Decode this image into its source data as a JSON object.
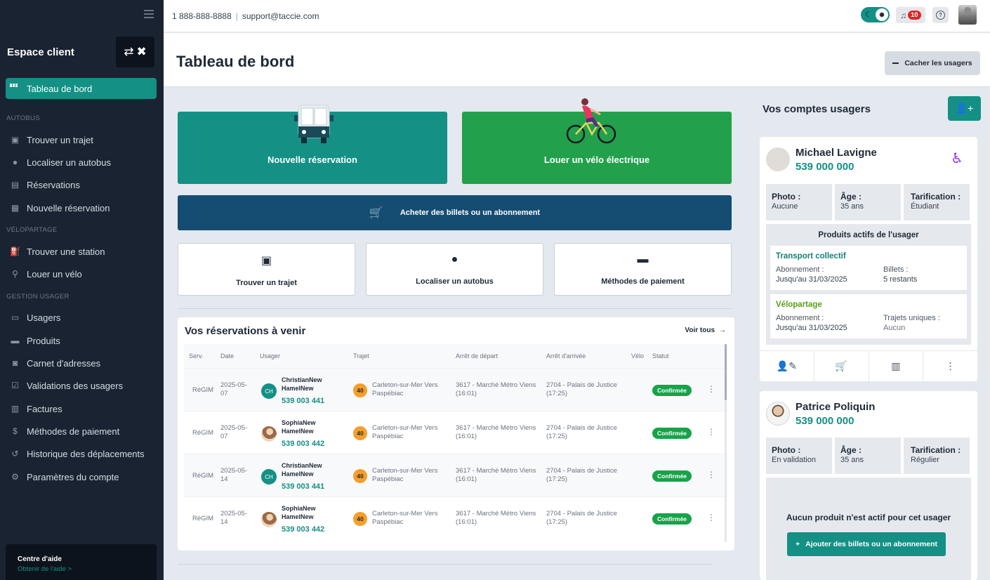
{
  "sidebar": {
    "title": "Espace client",
    "active": "Tableau de bord",
    "sections": {
      "autobus": "AUTOBUS",
      "velo": "VÉLOPARTAGE",
      "gestion": "GESTION USAGER"
    },
    "items": [
      {
        "label": "Trouver un trajet",
        "icon": "bus-icon"
      },
      {
        "label": "Localiser un autobus",
        "icon": "location-pin-icon"
      },
      {
        "label": "Réservations",
        "icon": "calendar-icon"
      },
      {
        "label": "Nouvelle réservation",
        "icon": "calendar-plus-icon"
      },
      {
        "label": "Trouver une station",
        "icon": "station-icon"
      },
      {
        "label": "Louer un vélo",
        "icon": "bike-icon"
      },
      {
        "label": "Usagers",
        "icon": "id-card-icon"
      },
      {
        "label": "Produits",
        "icon": "ticket-icon"
      },
      {
        "label": "Carnet d'adresses",
        "icon": "address-book-icon"
      },
      {
        "label": "Validations des usagers",
        "icon": "check-card-icon"
      },
      {
        "label": "Factures",
        "icon": "invoice-icon"
      },
      {
        "label": "Méthodes de paiement",
        "icon": "dollar-icon"
      },
      {
        "label": "Historique des déplacements",
        "icon": "history-icon"
      },
      {
        "label": "Paramètres du compte",
        "icon": "gear-icon"
      }
    ],
    "help_title": "Centre d'aide",
    "help_link": "Obtenir de l'aide >"
  },
  "topbar": {
    "phone": "1 888-888-8888",
    "email": "support@taccie.com",
    "notif_count": "10"
  },
  "header": {
    "title": "Tableau de bord",
    "hide_users": "Cacher les usagers"
  },
  "actions": {
    "new_booking": "Nouvelle réservation",
    "rent_ebike": "Louer un vélo électrique",
    "buy_tickets": "Acheter des billets ou un abonnement",
    "find_trip": "Trouver un trajet",
    "locate_bus": "Localiser un autobus",
    "payment_methods": "Méthodes de paiement"
  },
  "reservations": {
    "title": "Vos réservations à venir",
    "see_all": "Voir tous",
    "columns": [
      "Serv.",
      "Date",
      "Usager",
      "Trajet",
      "Arrêt de départ",
      "Arrêt d'arrivée",
      "Vélo",
      "Statut"
    ],
    "rows": [
      {
        "serv": "RéGIM",
        "date": "2025-05-07",
        "initials": "CH",
        "first": "ChristianNew",
        "last": "HamelNew",
        "id": "539 003 441",
        "route": "40",
        "trajet": "Carleton-sur-Mer Vers Paspébiac",
        "dep": "3617 - Marché Métro Viens (16:01)",
        "arr": "2704 - Palais de Justice (17:25)",
        "status": "Confirmée"
      },
      {
        "serv": "RéGIM",
        "date": "2025-05-07",
        "initials": "",
        "first": "SophiaNew",
        "last": "HamelNew",
        "id": "539 003 442",
        "route": "40",
        "trajet": "Carleton-sur-Mer Vers Paspébiac",
        "dep": "3617 - Marché Métro Viens (16:01)",
        "arr": "2704 - Palais de Justice (17:25)",
        "status": "Confirmée"
      },
      {
        "serv": "RéGIM",
        "date": "2025-05-14",
        "initials": "CH",
        "first": "ChristianNew",
        "last": "HamelNew",
        "id": "539 003 441",
        "route": "40",
        "trajet": "Carleton-sur-Mer Vers Paspébiac",
        "dep": "3617 - Marché Métro Viens (16:01)",
        "arr": "2704 - Palais de Justice (17:25)",
        "status": "Confirmée"
      },
      {
        "serv": "RéGIM",
        "date": "2025-05-14",
        "initials": "",
        "first": "SophiaNew",
        "last": "HamelNew",
        "id": "539 003 442",
        "route": "40",
        "trajet": "Carleton-sur-Mer Vers Paspébiac",
        "dep": "3617 - Marché Métro Viens (16:01)",
        "arr": "2704 - Palais de Justice (17:25)",
        "status": "Confirmée"
      }
    ]
  },
  "users": {
    "title": "Vos comptes usagers",
    "labels": {
      "photo": "Photo :",
      "age": "Âge :",
      "pricing": "Tarification :"
    },
    "list": [
      {
        "name": "Michael Lavigne",
        "number": "539 000 000",
        "photo": "Aucune",
        "age": "35 ans",
        "pricing": "Étudiant",
        "products_title": "Produits actifs de l'usager",
        "transport": {
          "title": "Transport collectif",
          "l1": "Abonnement :",
          "v1": "Jusqu'au 31/03/2025",
          "l2": "Billets :",
          "v2": "5 restants"
        },
        "velo": {
          "title": "Vélopartage",
          "l1": "Abonnement :",
          "v1": "Jusqu'au 31/03/2025",
          "l2": "Trajets uniques :",
          "v2": "Aucun"
        }
      },
      {
        "name": "Patrice Poliquin",
        "number": "539 000 000",
        "photo": "En validation",
        "age": "35 ans",
        "pricing": "Régulier",
        "no_product": "Aucun produit n'est actif pour cet usager",
        "add_btn": "Ajouter des billets ou un abonnement"
      }
    ]
  },
  "colors": {
    "teal": "#149085",
    "green": "#22a04b",
    "navy": "#154d72",
    "sidebar": "#1a2332",
    "orange": "#f59e2a",
    "purple": "#9333ea"
  }
}
